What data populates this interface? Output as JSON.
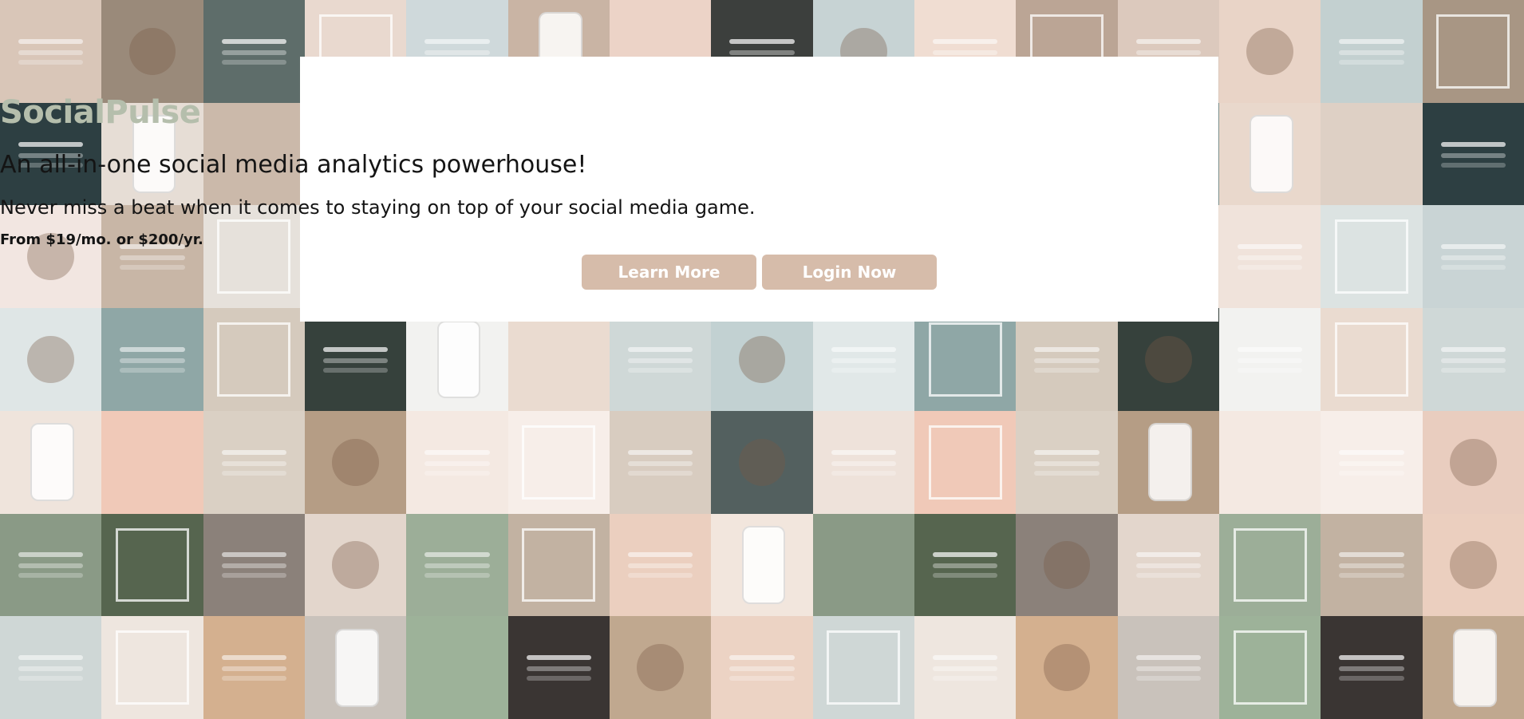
{
  "hero": {
    "brand": "SocialPulse",
    "tagline": "An all-in-one social media analytics powerhouse!",
    "subtagline": "Never miss a beat when it comes to staying on top of your social media game.",
    "price": "From $19/mo. or $200/yr.",
    "learn_more_label": "Learn More",
    "login_label": "Login Now"
  },
  "colors": {
    "brand": "#b5beac",
    "button": "#d6bcaa",
    "card": "#ffffff"
  },
  "background": {
    "tile_colors": [
      "#d9c6b8",
      "#9a8a7a",
      "#5e6d6a",
      "#e9d9cf",
      "#cfd9db",
      "#c9b4a4",
      "#ecd3c7",
      "#3c3f3d",
      "#c7d3d4",
      "#f0ddd2",
      "#bba595",
      "#dcc9bd",
      "#e9d4c7",
      "#c3d0d0",
      "#a89684",
      "#2d3f42",
      "#e6ddd5",
      "#cbb9aa",
      "#f2e2d8",
      "#e1e6e6",
      "#f6ece6",
      "#e8c9bb",
      "#d4c4b6",
      "#e0cfc4",
      "#b8c8c9",
      "#f4e6de",
      "#7a8f8c",
      "#e9d8cc",
      "#ded0c5",
      "#2d3f42",
      "#f2e6e1",
      "#c8b6a6",
      "#e6e1db",
      "#f4ebe5",
      "#dbe1e2",
      "#f3e0d6",
      "#d9c2b2",
      "#c7d2d3",
      "#ead8cc",
      "#d8dedf",
      "#e8cfc1",
      "#ecdfd5",
      "#f0e3db",
      "#dce3e2",
      "#c9d4d5",
      "#dfe6e6",
      "#8fa7a6",
      "#d5cabd",
      "#36413c",
      "#f2f2f0",
      "#eadbd0",
      "#cfd8d7",
      "#c2d1d2",
      "#e1e8e8",
      "#8fa7a6",
      "#d5cabd",
      "#36413c",
      "#f2f2f0",
      "#eadbd0",
      "#cfd8d7",
      "#efe4dc",
      "#f0c9b8",
      "#dad0c4",
      "#b59d85",
      "#f4e9e2",
      "#f7eee9",
      "#d8ccc0",
      "#53605f",
      "#eee2da",
      "#f0c9b8",
      "#dad0c4",
      "#b59d85",
      "#f4e9e2",
      "#f7eee9",
      "#e9cdbf",
      "#8a9a86",
      "#56654f",
      "#8b817a",
      "#e3d6cc",
      "#9cae98",
      "#c2b2a2",
      "#ebcfbf",
      "#f2e6dd",
      "#8a9a86",
      "#56654f",
      "#8b817a",
      "#e3d6cc",
      "#9cae98",
      "#c2b2a2",
      "#ebcfbf",
      "#cfd7d6",
      "#eee6df",
      "#d4b08f",
      "#c9c2bb",
      "#9db299",
      "#3a3533",
      "#c0a88f",
      "#ecd3c4",
      "#cfd7d6",
      "#eee6df",
      "#d4b08f",
      "#c9c2bb",
      "#9db299",
      "#3a3533",
      "#c0a88f"
    ]
  }
}
